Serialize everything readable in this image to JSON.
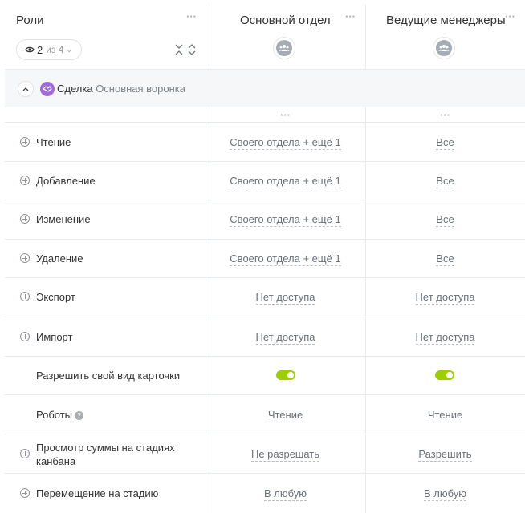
{
  "header": {
    "roles_title": "Роли",
    "roles_menu_icon": "more-dots-icon",
    "view_selector": {
      "icon": "eye-icon",
      "count": "2",
      "of_text": "из 4",
      "chevron": "chevron-down-icon"
    },
    "columns": [
      {
        "title": "Основной отдел",
        "avatar_icon": "group-icon"
      },
      {
        "title": "Ведущие менеджеры",
        "avatar_icon": "group-icon"
      }
    ],
    "sort_icons": [
      "collapse-icon",
      "expand-icon"
    ]
  },
  "section": {
    "title": "Сделка",
    "subtitle": "Основная воронка",
    "icon": "handshake-icon",
    "toggle_icon": "chevron-up-icon"
  },
  "rows": [
    {
      "label": "Чтение",
      "plus": true,
      "col1": "Своего отдела + ещё 1",
      "col2": "Все"
    },
    {
      "label": "Добавление",
      "plus": true,
      "col1": "Своего отдела + ещё 1",
      "col2": "Все"
    },
    {
      "label": "Изменение",
      "plus": true,
      "col1": "Своего отдела + ещё 1",
      "col2": "Все"
    },
    {
      "label": "Удаление",
      "plus": true,
      "col1": "Своего отдела + ещё 1",
      "col2": "Все"
    },
    {
      "label": "Экспорт",
      "plus": true,
      "col1": "Нет доступа",
      "col2": "Нет доступа"
    },
    {
      "label": "Импорт",
      "plus": true,
      "col1": "Нет доступа",
      "col2": "Нет доступа"
    },
    {
      "label": "Разрешить свой вид карточки",
      "plus": false,
      "toggle": true,
      "col1_on": true,
      "col2_on": true
    },
    {
      "label": "Роботы",
      "plus": false,
      "help": true,
      "col1": "Чтение",
      "col2": "Чтение"
    },
    {
      "label_line1": "Просмотр суммы на стадиях",
      "label_line2": "канбана",
      "plus": true,
      "col1": "Не разрешать",
      "col2": "Разрешить"
    },
    {
      "label": "Перемещение на стадию",
      "plus": true,
      "col1": "В любую",
      "col2": "В любую"
    }
  ],
  "colors": {
    "toggle_on": "#9dcf00",
    "deal_icon": "#a06bd8",
    "section_bg": "#f5f7f8"
  }
}
